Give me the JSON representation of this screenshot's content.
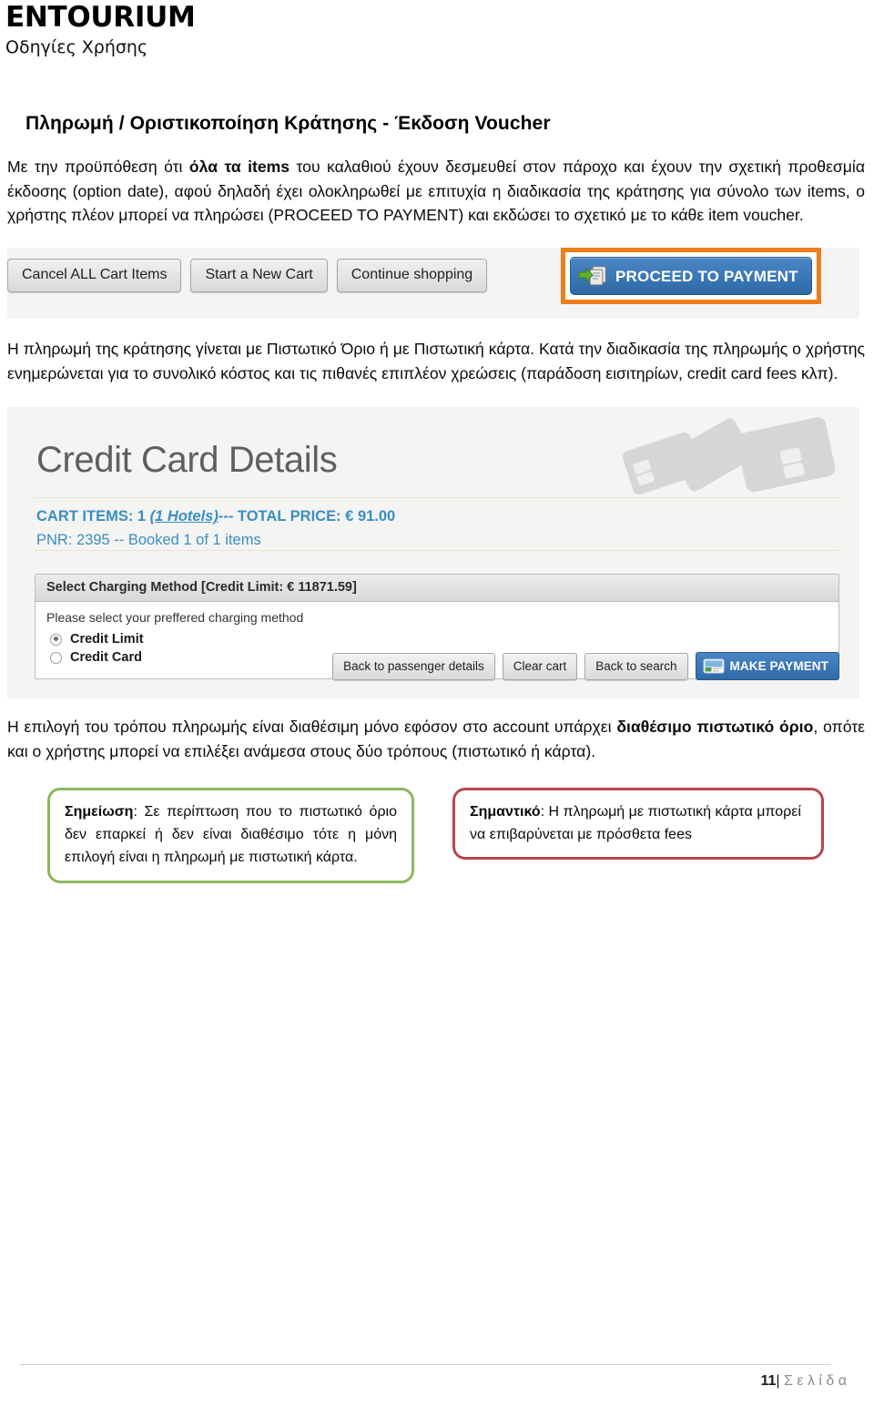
{
  "header": {
    "brand": "ENTOURIUM",
    "subtitle": "Οδηγίες Χρήσης"
  },
  "section": {
    "heading": "Πληρωμή / Οριστικοποίηση Κράτησης  -  Έκδοση Voucher"
  },
  "paragraphs": {
    "p1_a": "Με την προϋπόθεση ότι ",
    "p1_b": "όλα τα items",
    "p1_c": " του καλαθιού έχουν δεσμευθεί στον πάροχο και έχουν την σχετική προθεσμία έκδοσης (option date), αφού δηλαδή έχει ολοκληρωθεί με επιτυχία η διαδικασία της κράτησης για σύνολο των items, ο χρήστης πλέον μπορεί να πληρώσει (PROCEED TO PAYMENT) και εκδώσει το σχετικό με το κάθε item voucher.",
    "p2": "Η πληρωμή της κράτησης γίνεται με Πιστωτικό Όριο ή με Πιστωτική κάρτα. Κατά την διαδικασία της πληρωμής ο χρήστης ενημερώνεται για το συνολικό κόστος και τις πιθανές επιπλέον χρεώσεις (παράδοση εισιτηρίων, credit card fees κλπ).",
    "p3_a": "Η επιλογή του τρόπου πληρωμής είναι διαθέσιμη μόνο εφόσον στο account υπάρχει ",
    "p3_b": "διαθέσιμο πιστωτικό όριο",
    "p3_c": ", οπότε και ο χρήστης μπορεί να επιλέξει ανάμεσα στους δύο τρόπους (πιστωτικό ή κάρτα)."
  },
  "cart_toolbar": {
    "cancel_all": "Cancel ALL Cart Items",
    "start_new": "Start a New Cart",
    "continue_shopping": "Continue shopping",
    "proceed_to_payment": "PROCEED TO PAYMENT",
    "highlight_color": "#f07d1b",
    "primary_color": "#2f6aa8"
  },
  "credit_card_details": {
    "title": "Credit Card Details",
    "cart_items_prefix": "CART ITEMS: 1 ",
    "cart_items_hotels": "(1 Hotels)",
    "cart_items_suffix": "--- TOTAL PRICE: € 91.00",
    "pnr_line": "PNR: 2395 -- Booked 1 of 1 items",
    "accent_color": "#3a8ec0",
    "panel": {
      "header": "Select Charging Method [Credit Limit: € 11871.59]",
      "hint": "Please select your preffered charging method",
      "options": [
        {
          "label": "Credit Limit",
          "selected": true
        },
        {
          "label": "Credit Card",
          "selected": false
        }
      ]
    },
    "buttons": {
      "back_passenger": "Back to passenger details",
      "clear_cart": "Clear cart",
      "back_search": "Back to search",
      "make_payment": "MAKE PAYMENT"
    }
  },
  "callouts": {
    "note": {
      "label": "Σημείωση",
      "text": ": Σε περίπτωση που το πιστωτικό όριο δεν επαρκεί ή δεν είναι διαθέσιμο τότε η μόνη επιλογή είναι η πληρωμή με πιστωτική κάρτα.",
      "border_color": "#8cb860"
    },
    "important": {
      "label": "Σημαντικό",
      "text": ": Η πληρωμή με πιστωτική κάρτα μπορεί να επιβαρύνεται με πρόσθετα fees",
      "border_color": "#b8474a"
    }
  },
  "footer": {
    "page_number": "11",
    "separator": "|",
    "label": "Σ ε λ ί δ α"
  }
}
